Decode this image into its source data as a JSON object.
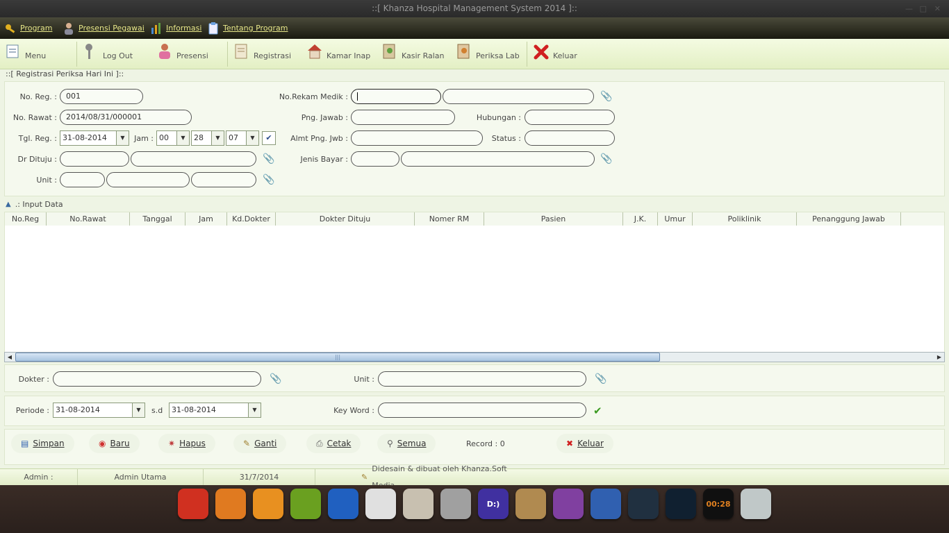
{
  "window": {
    "title": "::[ Khanza Hospital Management System 2014 ]::"
  },
  "menu": [
    {
      "label": "Program",
      "icon": "key-icon",
      "color": "#e0b020"
    },
    {
      "label": "Presensi Pegawai",
      "icon": "person-icon",
      "color": "#c8a080"
    },
    {
      "label": "Informasi",
      "icon": "chart-icon",
      "color": "#4a8ad0"
    },
    {
      "label": "Tentang Program",
      "icon": "clipboard-icon",
      "color": "#6aa0e0"
    }
  ],
  "toolbar": [
    {
      "label": "Menu",
      "icon": "menu-icon"
    },
    {
      "label": "Log Out",
      "icon": "logout-key-icon"
    },
    {
      "label": "Presensi",
      "icon": "presensi-person-icon"
    },
    {
      "label": "Registrasi",
      "icon": "registration-icon"
    },
    {
      "label": "Kamar Inap",
      "icon": "house-icon"
    },
    {
      "label": "Kasir Ralan",
      "icon": "cashier-icon"
    },
    {
      "label": "Periksa Lab",
      "icon": "lab-icon"
    },
    {
      "label": "Keluar",
      "icon": "close-red-icon"
    }
  ],
  "section_title": "::[ Registrasi Periksa Hari Ini ]::",
  "form": {
    "no_reg_label": "No. Reg. :",
    "no_reg_value": "001",
    "no_rawat_label": "No. Rawat :",
    "no_rawat_value": "2014/08/31/000001",
    "tgl_reg_label": "Tgl. Reg. :",
    "tgl_reg_value": "31-08-2014",
    "jam_label": "Jam :",
    "jam_hour": "00",
    "jam_minute": "28",
    "jam_second": "07",
    "dr_dituju_label": "Dr Dituju :",
    "unit_label": "Unit :",
    "no_rm_label": "No.Rekam Medik :",
    "png_jawab_label": "Png. Jawab :",
    "hubungan_label": "Hubungan :",
    "almt_label": "Almt Png. Jwb :",
    "status_label": "Status :",
    "jenis_bayar_label": "Jenis Bayar :"
  },
  "input_data_label": ".: Input Data",
  "table": {
    "columns": [
      "No.Reg",
      "No.Rawat",
      "Tanggal",
      "Jam",
      "Kd.Dokter",
      "Dokter Dituju",
      "Nomer RM",
      "Pasien",
      "J.K.",
      "Umur",
      "Poliklinik",
      "Penanggung Jawab"
    ],
    "rows": []
  },
  "filter": {
    "dokter_label": "Dokter :",
    "unit_label": "Unit :",
    "periode_label": "Periode :",
    "periode_from": "31-08-2014",
    "sd_label": "s.d",
    "periode_to": "31-08-2014",
    "keyword_label": "Key Word :"
  },
  "buttons": {
    "simpan": "Simpan",
    "baru": "Baru",
    "hapus": "Hapus",
    "ganti": "Ganti",
    "cetak": "Cetak",
    "semua": "Semua",
    "record": "Record : 0",
    "keluar": "Keluar"
  },
  "status": {
    "admin_label": "Admin :",
    "admin_name": "Admin Utama",
    "date": "31/7/2014",
    "credit": "Didesain & dibuat oleh Khanza.Soft Media"
  },
  "dock": [
    {
      "name": "rocket-icon",
      "color": "#d03020"
    },
    {
      "name": "store-icon",
      "color": "#e07a20"
    },
    {
      "name": "swirl-icon",
      "color": "#e89020"
    },
    {
      "name": "music-icon",
      "color": "#6aa020"
    },
    {
      "name": "globe-icon",
      "color": "#2060c0"
    },
    {
      "name": "chrome-icon",
      "color": "#e0e0e0"
    },
    {
      "name": "folder-icon",
      "color": "#c8c0b0"
    },
    {
      "name": "settings-icon",
      "color": "#a0a0a0"
    },
    {
      "name": "deepin-icon",
      "color": "#4030a0",
      "text": "D:)"
    },
    {
      "name": "mail-icon",
      "color": "#b08a50"
    },
    {
      "name": "video-icon",
      "color": "#8040a0"
    },
    {
      "name": "browser-icon",
      "color": "#3060b0"
    },
    {
      "name": "camera-icon",
      "color": "#203040"
    },
    {
      "name": "player-icon",
      "color": "#102030"
    },
    {
      "name": "clock-icon",
      "color": "#101010",
      "text": "00:28"
    },
    {
      "name": "trash-icon",
      "color": "#c0c8c8"
    }
  ]
}
